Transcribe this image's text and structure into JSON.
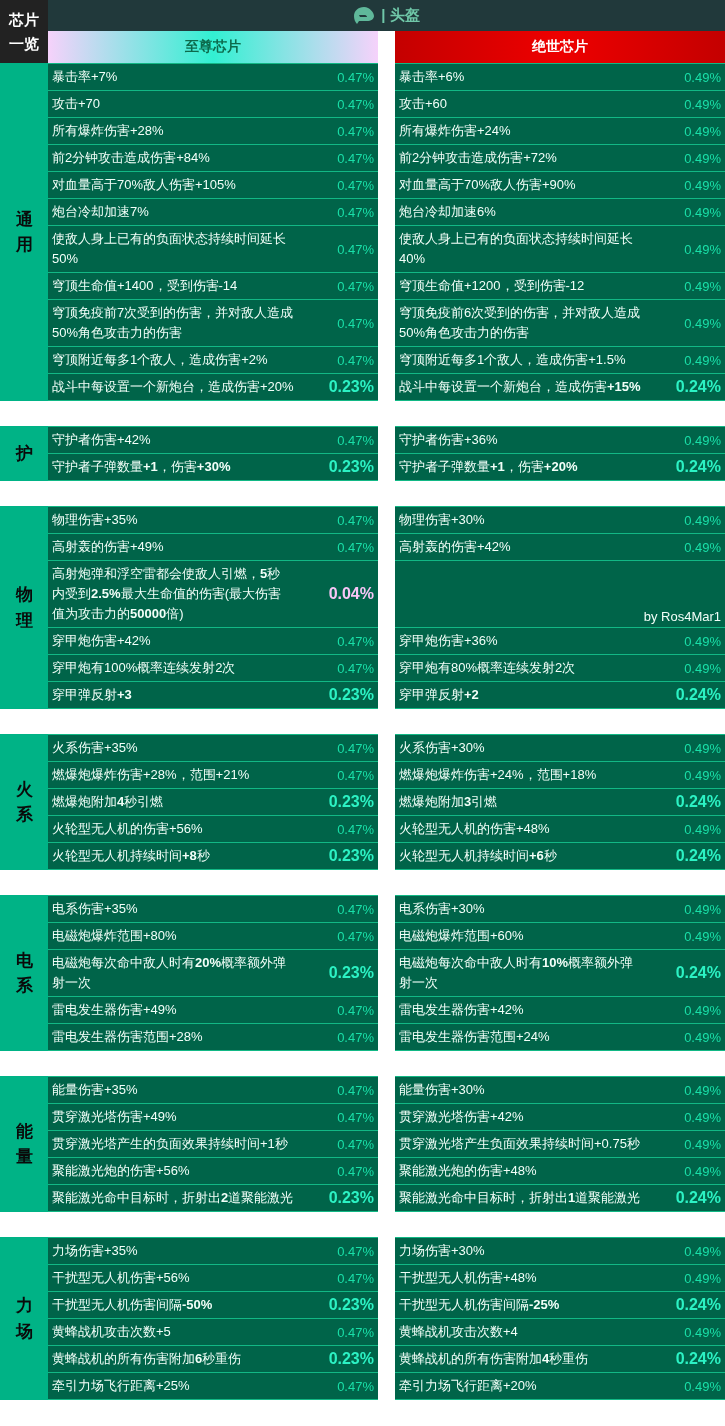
{
  "corner_label": "芯片一览",
  "title": "| 头盔",
  "tiers": [
    {
      "label": "至尊芯片",
      "kind": "supreme"
    },
    {
      "label": "绝世芯片",
      "kind": "peerless"
    }
  ],
  "sections": [
    {
      "label": "通用",
      "rows": [
        {
          "left": {
            "text": "暴击率+7%",
            "chance": "0.47%",
            "kind": "common"
          },
          "right": {
            "text": "暴击率+6%",
            "chance": "0.49%",
            "kind": "common"
          }
        },
        {
          "left": {
            "text": "攻击+70",
            "chance": "0.47%",
            "kind": "common"
          },
          "right": {
            "text": "攻击+60",
            "chance": "0.49%",
            "kind": "common"
          }
        },
        {
          "left": {
            "text": "所有爆炸伤害+28%",
            "chance": "0.47%",
            "kind": "common"
          },
          "right": {
            "text": "所有爆炸伤害+24%",
            "chance": "0.49%",
            "kind": "common"
          }
        },
        {
          "left": {
            "text": "前2分钟攻击造成伤害+84%",
            "chance": "0.47%",
            "kind": "common"
          },
          "right": {
            "text": "前2分钟攻击造成伤害+72%",
            "chance": "0.49%",
            "kind": "common"
          }
        },
        {
          "left": {
            "text": "对血量高于70%敌人伤害+105%",
            "chance": "0.47%",
            "kind": "common"
          },
          "right": {
            "text": "对血量高于70%敌人伤害+90%",
            "chance": "0.49%",
            "kind": "common"
          }
        },
        {
          "left": {
            "text": "炮台冷却加速7%",
            "chance": "0.47%",
            "kind": "common"
          },
          "right": {
            "text": "炮台冷却加速6%",
            "chance": "0.49%",
            "kind": "common"
          }
        },
        {
          "left": {
            "text": "使敌人身上已有的负面状态持续时间延长50%",
            "chance": "0.47%",
            "kind": "common"
          },
          "right": {
            "text": "使敌人身上已有的负面状态持续时间延长40%",
            "chance": "0.49%",
            "kind": "common"
          }
        },
        {
          "left": {
            "text": "穹顶生命值+1400，受到伤害-14",
            "chance": "0.47%",
            "kind": "common"
          },
          "right": {
            "text": "穹顶生命值+1200，受到伤害-12",
            "chance": "0.49%",
            "kind": "common"
          }
        },
        {
          "left": {
            "text": "穹顶免疫前7次受到的伤害，并对敌人造成50%角色攻击力的伤害",
            "chance": "0.47%",
            "kind": "common"
          },
          "right": {
            "text": "穹顶免疫前6次受到的伤害，并对敌人造成50%角色攻击力的伤害",
            "chance": "0.49%",
            "kind": "common"
          }
        },
        {
          "left": {
            "text": "穹顶附近每多1个敌人，造成伤害+2%",
            "chance": "0.47%",
            "kind": "common"
          },
          "right": {
            "text": "穹顶附近每多1个敌人，造成伤害+1.5%",
            "chance": "0.49%",
            "kind": "common"
          }
        },
        {
          "left": {
            "text": "战斗中每设置一个新炮台，造成伤害+20%",
            "chance": "0.23%",
            "kind": "rare"
          },
          "right": {
            "text": "战斗中每设置一个新炮台，造成伤害**+15%**",
            "chance": "0.24%",
            "kind": "rare"
          }
        }
      ]
    },
    {
      "label": "护",
      "rows": [
        {
          "left": {
            "text": "守护者伤害+42%",
            "chance": "0.47%",
            "kind": "common"
          },
          "right": {
            "text": "守护者伤害+36%",
            "chance": "0.49%",
            "kind": "common"
          }
        },
        {
          "left": {
            "text": "守护者子弹数量**+1**，伤害**+30%**",
            "chance": "0.23%",
            "kind": "rare"
          },
          "right": {
            "text": "守护者子弹数量**+1**，伤害**+20%**",
            "chance": "0.24%",
            "kind": "rare"
          }
        }
      ]
    },
    {
      "label": "物理",
      "rows": [
        {
          "left": {
            "text": "物理伤害+35%",
            "chance": "0.47%",
            "kind": "common"
          },
          "right": {
            "text": "物理伤害+30%",
            "chance": "0.49%",
            "kind": "common"
          }
        },
        {
          "left": {
            "text": "高射轰的伤害+49%",
            "chance": "0.47%",
            "kind": "common"
          },
          "right": {
            "text": "高射轰的伤害+42%",
            "chance": "0.49%",
            "kind": "common"
          }
        },
        {
          "left": {
            "text": "高射炮弹和浮空雷都会使敌人引燃，**5**秒内受到**2.5%**最大生命值的伤害(最大伤害值为攻击力的**50000**倍)",
            "chance": "0.04%",
            "kind": "unique"
          },
          "right": {
            "kind": "blank",
            "note": "by Ros4Mar1"
          }
        },
        {
          "left": {
            "text": "穿甲炮伤害+42%",
            "chance": "0.47%",
            "kind": "common"
          },
          "right": {
            "text": "穿甲炮伤害+36%",
            "chance": "0.49%",
            "kind": "common"
          }
        },
        {
          "left": {
            "text": "穿甲炮有100%概率连续发射2次",
            "chance": "0.47%",
            "kind": "common"
          },
          "right": {
            "text": "穿甲炮有80%概率连续发射2次",
            "chance": "0.49%",
            "kind": "common"
          }
        },
        {
          "left": {
            "text": "穿甲弹反射**+3**",
            "chance": "0.23%",
            "kind": "rare"
          },
          "right": {
            "text": "穿甲弹反射**+2**",
            "chance": "0.24%",
            "kind": "rare"
          }
        }
      ]
    },
    {
      "label": "火系",
      "rows": [
        {
          "left": {
            "text": "火系伤害+35%",
            "chance": "0.47%",
            "kind": "common"
          },
          "right": {
            "text": "火系伤害+30%",
            "chance": "0.49%",
            "kind": "common"
          }
        },
        {
          "left": {
            "text": "燃爆炮爆炸伤害+28%，范围+21%",
            "chance": "0.47%",
            "kind": "common"
          },
          "right": {
            "text": "燃爆炮爆炸伤害+24%，范围+18%",
            "chance": "0.49%",
            "kind": "common"
          }
        },
        {
          "left": {
            "text": "燃爆炮附加**4**秒引燃",
            "chance": "0.23%",
            "kind": "rare"
          },
          "right": {
            "text": "燃爆炮附加**3**引燃",
            "chance": "0.24%",
            "kind": "rare"
          }
        },
        {
          "left": {
            "text": "火轮型无人机的伤害+56%",
            "chance": "0.47%",
            "kind": "common"
          },
          "right": {
            "text": "火轮型无人机的伤害+48%",
            "chance": "0.49%",
            "kind": "common"
          }
        },
        {
          "left": {
            "text": "火轮型无人机持续时间**+8**秒",
            "chance": "0.23%",
            "kind": "rare"
          },
          "right": {
            "text": "火轮型无人机持续时间**+6**秒",
            "chance": "0.24%",
            "kind": "rare"
          }
        }
      ]
    },
    {
      "label": "电系",
      "rows": [
        {
          "left": {
            "text": "电系伤害+35%",
            "chance": "0.47%",
            "kind": "common"
          },
          "right": {
            "text": "电系伤害+30%",
            "chance": "0.49%",
            "kind": "common"
          }
        },
        {
          "left": {
            "text": "电磁炮爆炸范围+80%",
            "chance": "0.47%",
            "kind": "common"
          },
          "right": {
            "text": "电磁炮爆炸范围+60%",
            "chance": "0.49%",
            "kind": "common"
          }
        },
        {
          "left": {
            "text": "电磁炮每次命中敌人时有**20%**概率额外弹射一次",
            "chance": "0.23%",
            "kind": "rare"
          },
          "right": {
            "text": "电磁炮每次命中敌人时有**10%**概率额外弹射一次",
            "chance": "0.24%",
            "kind": "rare"
          }
        },
        {
          "left": {
            "text": "雷电发生器伤害+49%",
            "chance": "0.47%",
            "kind": "common"
          },
          "right": {
            "text": "雷电发生器伤害+42%",
            "chance": "0.49%",
            "kind": "common"
          }
        },
        {
          "left": {
            "text": "雷电发生器伤害范围+28%",
            "chance": "0.47%",
            "kind": "common"
          },
          "right": {
            "text": "雷电发生器伤害范围+24%",
            "chance": "0.49%",
            "kind": "common"
          }
        }
      ]
    },
    {
      "label": "能量",
      "rows": [
        {
          "left": {
            "text": "能量伤害+35%",
            "chance": "0.47%",
            "kind": "common"
          },
          "right": {
            "text": "能量伤害+30%",
            "chance": "0.49%",
            "kind": "common"
          }
        },
        {
          "left": {
            "text": "贯穿激光塔伤害+49%",
            "chance": "0.47%",
            "kind": "common"
          },
          "right": {
            "text": "贯穿激光塔伤害+42%",
            "chance": "0.49%",
            "kind": "common"
          }
        },
        {
          "left": {
            "text": "贯穿激光塔产生的负面效果持续时间+1秒",
            "chance": "0.47%",
            "kind": "common"
          },
          "right": {
            "text": "贯穿激光塔产生负面效果持续时间+0.75秒",
            "chance": "0.49%",
            "kind": "common"
          }
        },
        {
          "left": {
            "text": "聚能激光炮的伤害+56%",
            "chance": "0.47%",
            "kind": "common"
          },
          "right": {
            "text": "聚能激光炮的伤害+48%",
            "chance": "0.49%",
            "kind": "common"
          }
        },
        {
          "left": {
            "text": "聚能激光命中目标时，折射出**2**道聚能激光",
            "chance": "0.23%",
            "kind": "rare"
          },
          "right": {
            "text": "聚能激光命中目标时，折射出**1**道聚能激光",
            "chance": "0.24%",
            "kind": "rare"
          }
        }
      ]
    },
    {
      "label": "力场",
      "rows": [
        {
          "left": {
            "text": "力场伤害+35%",
            "chance": "0.47%",
            "kind": "common"
          },
          "right": {
            "text": "力场伤害+30%",
            "chance": "0.49%",
            "kind": "common"
          }
        },
        {
          "left": {
            "text": "干扰型无人机伤害+56%",
            "chance": "0.47%",
            "kind": "common"
          },
          "right": {
            "text": "干扰型无人机伤害+48%",
            "chance": "0.49%",
            "kind": "common"
          }
        },
        {
          "left": {
            "text": "干扰型无人机伤害间隔**-50%**",
            "chance": "0.23%",
            "kind": "rare"
          },
          "right": {
            "text": "干扰型无人机伤害间隔**-25%**",
            "chance": "0.24%",
            "kind": "rare"
          }
        },
        {
          "left": {
            "text": "黄蜂战机攻击次数+5",
            "chance": "0.47%",
            "kind": "common"
          },
          "right": {
            "text": "黄蜂战机攻击次数+4",
            "chance": "0.49%",
            "kind": "common"
          }
        },
        {
          "left": {
            "text": "黄蜂战机的所有伤害附加**6**秒重伤",
            "chance": "0.23%",
            "kind": "rare"
          },
          "right": {
            "text": "黄蜂战机的所有伤害附加**4**秒重伤",
            "chance": "0.24%",
            "kind": "rare"
          }
        },
        {
          "left": {
            "text": "牵引力场飞行距离+25%",
            "chance": "0.47%",
            "kind": "common"
          },
          "right": {
            "text": "牵引力场飞行距离+20%",
            "chance": "0.49%",
            "kind": "common"
          }
        }
      ]
    }
  ]
}
